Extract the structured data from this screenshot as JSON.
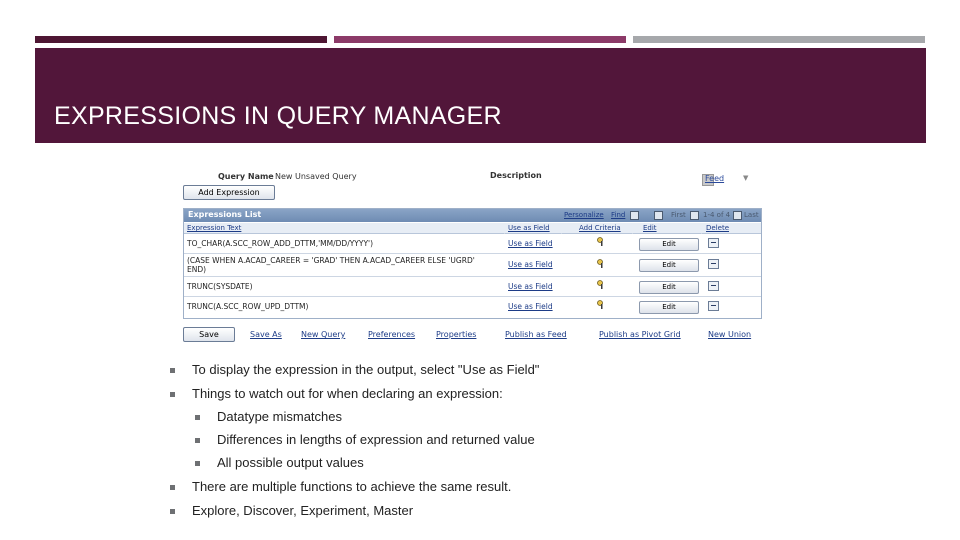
{
  "slide": {
    "title": "EXPRESSIONS IN QUERY MANAGER",
    "colors": {
      "title_band": "#52163a",
      "accent_bar_1": "#4e1633",
      "accent_bar_2": "#8c3a68",
      "accent_bar_3": "#a6a8ab"
    }
  },
  "screenshot": {
    "query_name_label": "Query Name",
    "query_name_value": "New Unsaved Query",
    "description_label": "Description",
    "feed_label": "Feed",
    "add_expression_label": "Add Expression",
    "grid": {
      "title": "Expressions List",
      "personalize_label": "Personalize",
      "find_label": "Find",
      "first_label": "First",
      "range_label": "1-4 of 4",
      "last_label": "Last",
      "columns": [
        "Expression Text",
        "Use as Field",
        "Add Criteria",
        "Edit",
        "Delete"
      ],
      "rows": [
        {
          "expression": "TO_CHAR(A.SCC_ROW_ADD_DTTM,'MM/DD/YYYY')",
          "use_as_field": "Use as Field",
          "edit": "Edit"
        },
        {
          "expression": "(CASE WHEN A.ACAD_CAREER = 'GRAD' THEN A.ACAD_CAREER ELSE 'UGRD' END)",
          "use_as_field": "Use as Field",
          "edit": "Edit"
        },
        {
          "expression": "TRUNC(SYSDATE)",
          "use_as_field": "Use as Field",
          "edit": "Edit"
        },
        {
          "expression": "TRUNC(A.SCC_ROW_UPD_DTTM)",
          "use_as_field": "Use as Field",
          "edit": "Edit"
        }
      ]
    },
    "footer": {
      "save_label": "Save",
      "links": [
        "Save As",
        "New Query",
        "Preferences",
        "Properties",
        "Publish as Feed",
        "Publish as Pivot Grid",
        "New Union"
      ]
    }
  },
  "bullets": [
    {
      "text": "To display the expression in the output, select \"Use as Field\"",
      "level": 1
    },
    {
      "text": "Things to watch out for when declaring an expression:",
      "level": 1
    },
    {
      "text": "Datatype mismatches",
      "level": 2
    },
    {
      "text": "Differences in lengths of expression and returned value",
      "level": 2
    },
    {
      "text": "All possible output values",
      "level": 2
    },
    {
      "text": "There are multiple functions to achieve the same result.",
      "level": 1
    },
    {
      "text": "Explore, Discover, Experiment, Master",
      "level": 1
    }
  ]
}
